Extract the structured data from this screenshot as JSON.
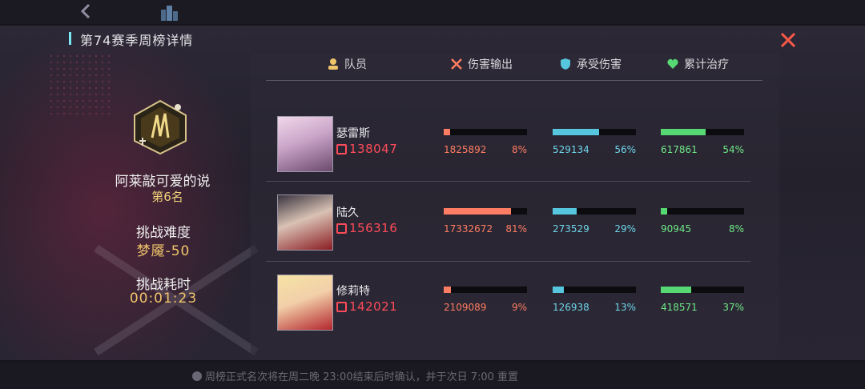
{
  "title": "第74赛季周榜详情",
  "player": {
    "name": "阿莱敲可爱的说",
    "rank": "第6名",
    "difficulty_label": "挑战难度",
    "difficulty_value": "梦魇-50",
    "time_label": "挑战耗时",
    "time_value": "00:01:23"
  },
  "columns": {
    "member": "队员",
    "damage": "伤害输出",
    "taken": "承受伤害",
    "heal": "累计治疗"
  },
  "colors": {
    "damage": "#ff7d62",
    "taken": "#56c6de",
    "heal": "#56d873",
    "power": "#ff4b5a",
    "close": "#ff5a48"
  },
  "rows": [
    {
      "name": "瑟雷斯",
      "power": "138047",
      "damage": {
        "value": "1825892",
        "pct": "8%",
        "fraction": 0.08
      },
      "taken": {
        "value": "529134",
        "pct": "56%",
        "fraction": 0.56
      },
      "heal": {
        "value": "617861",
        "pct": "54%",
        "fraction": 0.54
      }
    },
    {
      "name": "陆久",
      "power": "156316",
      "damage": {
        "value": "17332672",
        "pct": "81%",
        "fraction": 0.81
      },
      "taken": {
        "value": "273529",
        "pct": "29%",
        "fraction": 0.29
      },
      "heal": {
        "value": "90945",
        "pct": "8%",
        "fraction": 0.08
      }
    },
    {
      "name": "修莉特",
      "power": "142021",
      "damage": {
        "value": "2109089",
        "pct": "9%",
        "fraction": 0.09
      },
      "taken": {
        "value": "126938",
        "pct": "13%",
        "fraction": 0.13
      },
      "heal": {
        "value": "418571",
        "pct": "37%",
        "fraction": 0.37
      }
    }
  ],
  "footer": "周榜正式名次将在周二晚 23:00结束后时确认，并于次日 7:00 重置"
}
